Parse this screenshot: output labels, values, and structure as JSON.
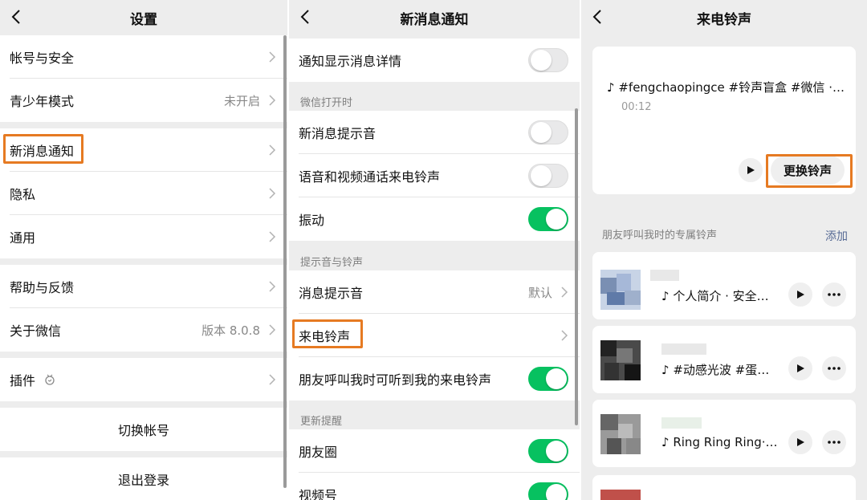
{
  "settings": {
    "title": "设置",
    "items": [
      {
        "label": "帐号与安全",
        "value": ""
      },
      {
        "label": "青少年模式",
        "value": "未开启"
      },
      {
        "label": "新消息通知",
        "value": ""
      },
      {
        "label": "隐私",
        "value": ""
      },
      {
        "label": "通用",
        "value": ""
      },
      {
        "label": "帮助与反馈",
        "value": ""
      },
      {
        "label": "关于微信",
        "value": "版本 8.0.8"
      },
      {
        "label": "插件",
        "value": ""
      }
    ],
    "switch_account": "切换帐号",
    "logout": "退出登录"
  },
  "notify": {
    "title": "新消息通知",
    "show_detail": "通知显示消息详情",
    "section_open": "微信打开时",
    "new_msg_sound": "新消息提示音",
    "call_ringtone": "语音和视频通话来电铃声",
    "vibrate": "振动",
    "section_sound": "提示音与铃声",
    "msg_sound": "消息提示音",
    "msg_sound_value": "默认",
    "ringtone": "来电铃声",
    "friends_hear": "朋友呼叫我时可听到我的来电铃声",
    "section_update": "更新提醒",
    "moments": "朋友圈",
    "channels": "视频号",
    "toggles": {
      "show_detail": false,
      "new_msg_sound": false,
      "call_ringtone": false,
      "vibrate": true,
      "friends_hear": true,
      "moments": true,
      "channels": true
    }
  },
  "ringtone": {
    "title": "来电铃声",
    "current": "♪ #fengchaopingce #铃声盲盒 #微信 ·…",
    "duration": "00:12",
    "change_button": "更换铃声",
    "friends_section": "朋友呼叫我时的专属铃声",
    "add": "添加",
    "friends": [
      {
        "song": "♪ 个人简介 · 安全…"
      },
      {
        "song": "♪ #动感光波 #蛋…"
      },
      {
        "song": "♪ Ring Ring Ring·…"
      }
    ]
  },
  "colors": {
    "toggle_on": "#07c160",
    "highlight": "#e67a22",
    "link": "#576b95"
  }
}
